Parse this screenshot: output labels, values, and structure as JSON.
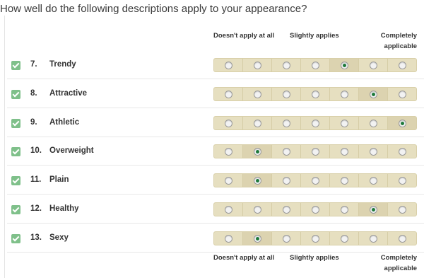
{
  "question": "How well do the following descriptions apply to your appearance?",
  "scale_labels": {
    "left": "Doesn't apply at all",
    "middle": "Slightly applies",
    "right": "Completely applicable"
  },
  "points": 7,
  "items": [
    {
      "number": "7.",
      "label": "Trendy",
      "selected": 5
    },
    {
      "number": "8.",
      "label": "Attractive",
      "selected": 6
    },
    {
      "number": "9.",
      "label": "Athletic",
      "selected": 7
    },
    {
      "number": "10.",
      "label": "Overweight",
      "selected": 2
    },
    {
      "number": "11.",
      "label": "Plain",
      "selected": 2
    },
    {
      "number": "12.",
      "label": "Healthy",
      "selected": 6
    },
    {
      "number": "13.",
      "label": "Sexy",
      "selected": 2
    }
  ],
  "colors": {
    "check": "#7fc08a",
    "track": "#e6dfc0",
    "selected_dot": "#1f7a3c"
  }
}
